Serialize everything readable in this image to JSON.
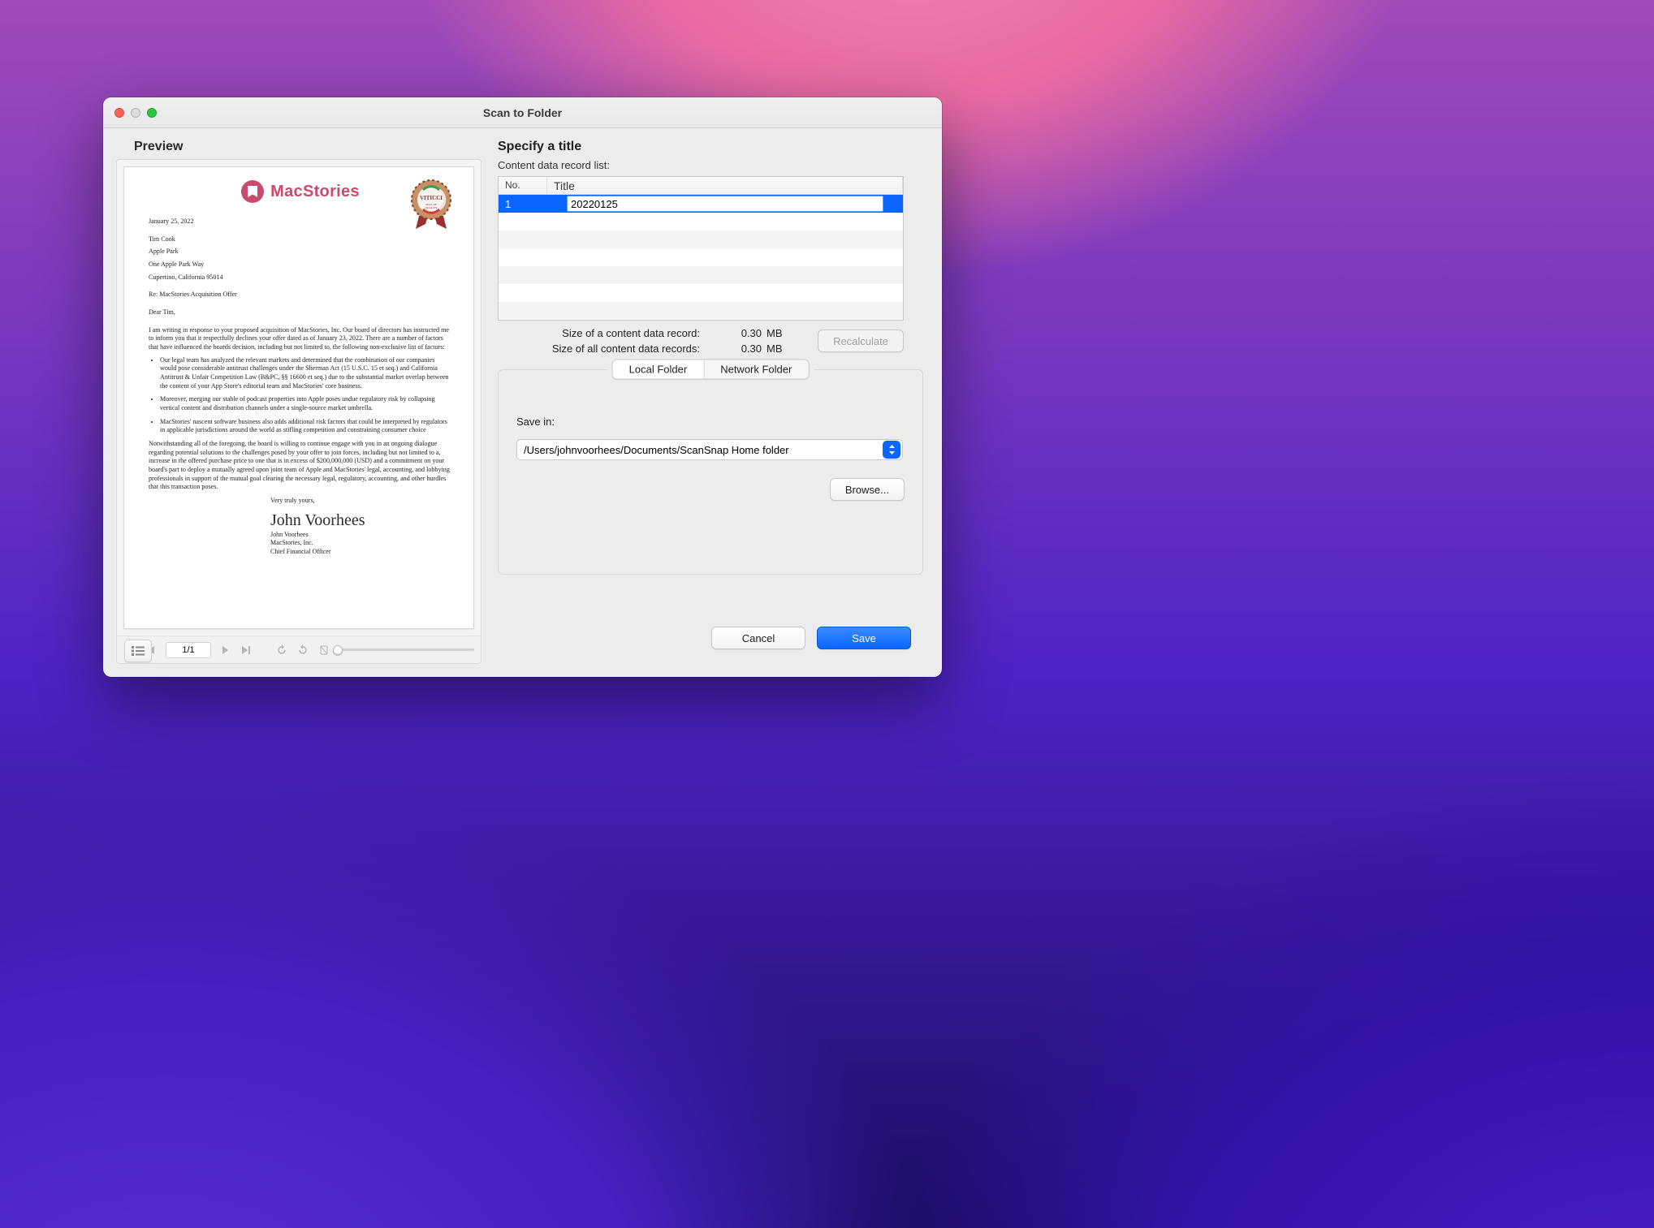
{
  "window": {
    "title": "Scan to Folder"
  },
  "preview": {
    "heading": "Preview",
    "page_counter": "1/1",
    "letter": {
      "brand": "MacStories",
      "seal_text": "VITICCI",
      "date": "January 25, 2022",
      "addr1": "Tim Cook",
      "addr2": "Apple Park",
      "addr3": "One Apple Park Way",
      "addr4": "Cupertino, California 95014",
      "subject": "Re: MacStories Acquisition Offer",
      "salutation": "Dear Tim,",
      "p1": "I am writing in response to your proposed acquisition of MacStories, Inc. Our board of directors has instructed me to inform you that it respectfully declines your offer dated as of January 23, 2022. There are a number of factors that have influenced the boards decision, including but not limited to, the following non-exclusive list of factors:",
      "b1": "Our legal team has analyzed the relevant markets and determined that the combination of our companies would pose considerable antitrust challenges under the Sherman Act (15 U.S.C. 15 et seq.) and California Antitrust & Unfair Competition Law (B&PC, §§ 16600 et seq.) due to the substantial market overlap between the content of your App Store's editorial team and MacStories' core business.",
      "b2": "Moreover, merging our stable of podcast properties into Apple poses undue regulatory risk by collapsing vertical content and distribution channels under a single-source market umbrella.",
      "b3": "MacStories' nascent software business also adds additional risk factors that could be interpreted by regulators in applicable jurisdictions around the world as stifling competition and constraining consumer choice",
      "p2": "Notwithstanding all of the foregoing, the board is willing to continue engage with you in an ongoing dialogue regarding potential solutions to the challenges posed by your offer to join forces, including but not limited to a, increase in the offered purchase price to one that is in excess of $200,000,000 (USD) and a commitment on your board's part to deploy a mutually agreed upon joint team of Apple and MacStories' legal, accounting, and lobbying professionals in support of the mutual goal clearing the necessary legal, regulatory, accounting, and other hurdles that this transaction poses.",
      "closing": "Very truly yours,",
      "signature": "John Voorhees",
      "sig1": "John Voorhees",
      "sig2": "MacStories, Inc.",
      "sig3": "Chief Financial Officer"
    }
  },
  "specify": {
    "heading": "Specify a title",
    "list_label": "Content data record list:",
    "columns": {
      "no": "No.",
      "title": "Title"
    },
    "rows": [
      {
        "no": "1",
        "title": "20220125"
      }
    ],
    "size_one_label": "Size of a content data record:",
    "size_all_label": "Size of all content data records:",
    "size_one_value": "0.30",
    "size_all_value": "0.30",
    "size_unit": "MB",
    "recalculate": "Recalculate"
  },
  "folder": {
    "tab_local": "Local Folder",
    "tab_network": "Network Folder",
    "save_in_label": "Save in:",
    "save_in_value": "/Users/johnvoorhees/Documents/ScanSnap Home folder",
    "browse": "Browse..."
  },
  "footer": {
    "cancel": "Cancel",
    "save": "Save"
  }
}
